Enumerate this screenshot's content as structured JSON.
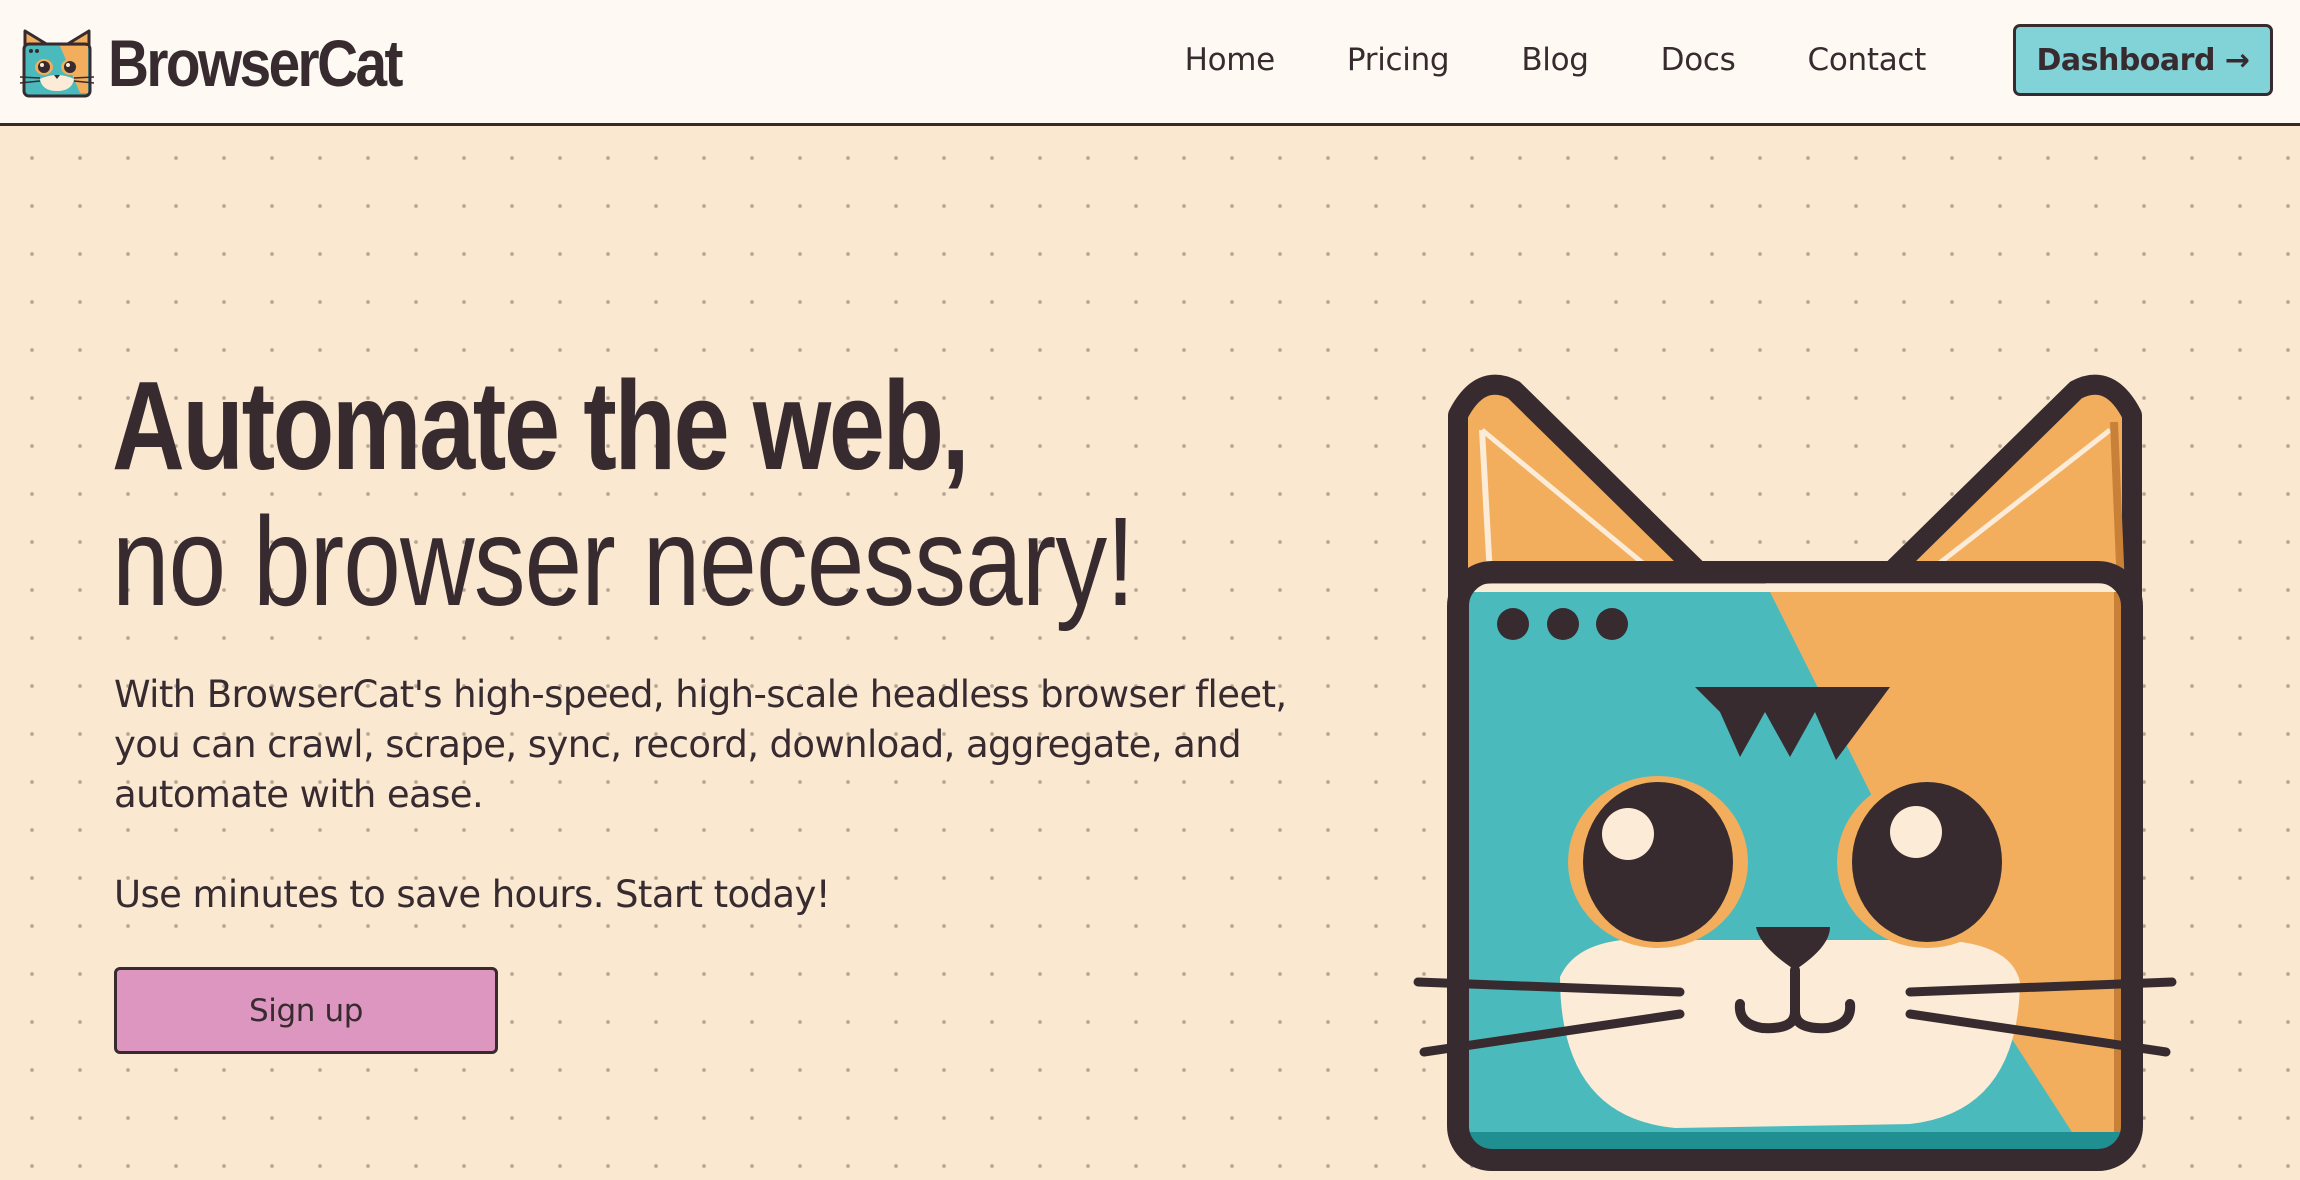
{
  "header": {
    "brand": "BrowserCat",
    "nav": [
      {
        "label": "Home"
      },
      {
        "label": "Pricing"
      },
      {
        "label": "Blog"
      },
      {
        "label": "Docs"
      },
      {
        "label": "Contact"
      }
    ],
    "dashboard_label": "Dashboard →"
  },
  "hero": {
    "headline_bold": "Automate the web,",
    "headline_regular": "no browser necessary!",
    "description": "With BrowserCat's high-speed, high-scale headless browser fleet, you can crawl, scrape, sync, record, download, aggregate, and automate with ease.",
    "cta_text": "Use minutes to save hours. Start today!",
    "signup_label": "Sign up"
  },
  "icons": {
    "logo": "cat-browser-logo-icon",
    "hero": "cat-browser-illustration"
  },
  "colors": {
    "background": "#fae8d1",
    "header_background": "#fef9f2",
    "text": "#372b30",
    "dashboard_button": "#82d3d7",
    "signup_button": "#dd96c0",
    "cat_orange": "#f2ae5c",
    "cat_teal": "#4bbabd",
    "cat_cream": "#fcebd6"
  }
}
